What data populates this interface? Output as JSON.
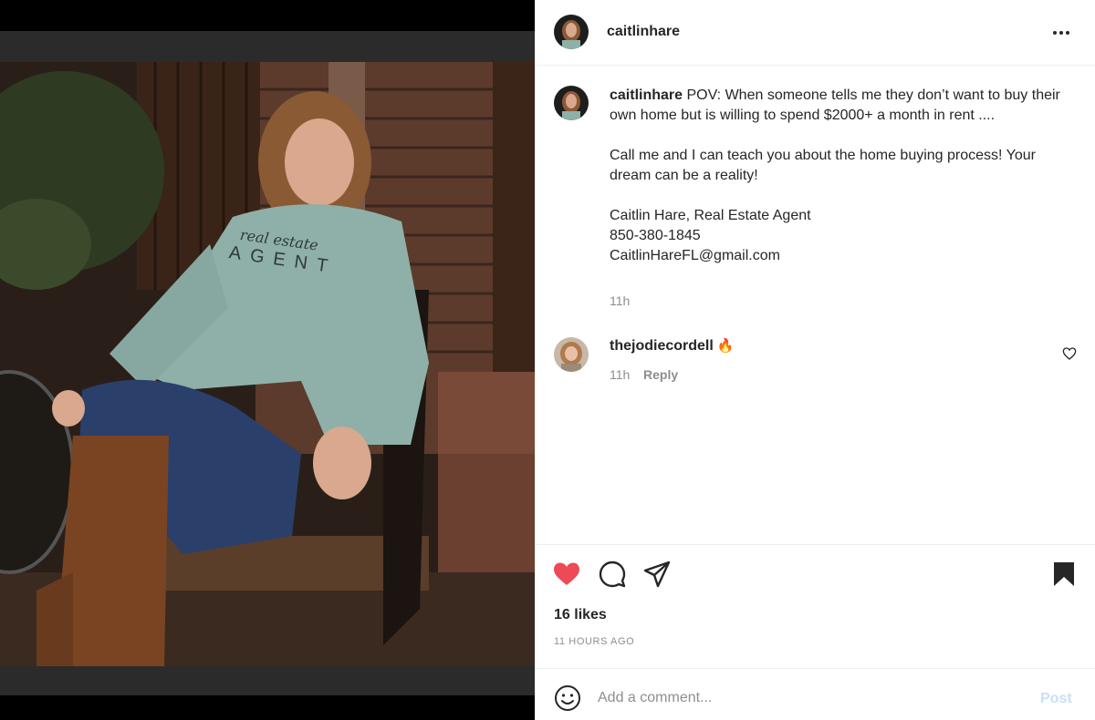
{
  "post": {
    "author": "caitlinhare",
    "caption_body_line1": "POV: When someone tells me they don’t want to buy their own home but is willing to spend $2000+ a month in rent ....",
    "caption_line2": "Call me and I can teach you about the home buying process! Your dream can be a reality!",
    "caption_line3": "Caitlin Hare, Real Estate Agent",
    "caption_line4": "850-380-1845",
    "caption_line5": "CaitlinHareFL@gmail.com",
    "caption_time": "11h",
    "likes": "16 likes",
    "posted_ago": "11 HOURS AGO",
    "is_liked": true,
    "is_saved": true
  },
  "comments": [
    {
      "author": "thejodiecordell",
      "emoji": "🔥",
      "time": "11h",
      "reply_label": "Reply"
    }
  ],
  "composer": {
    "placeholder": "Add a comment...",
    "post_label": "Post"
  },
  "media": {
    "sweatshirt_text_script": "real estate",
    "sweatshirt_text_caps": "AGENT"
  },
  "colors": {
    "like_red": "#ed4956",
    "text_primary": "#262626",
    "text_secondary": "#8e8e8e",
    "post_disabled": "#c7dff7"
  },
  "icons": {
    "header_menu": "more-horizontal-icon",
    "like": "heart-filled-icon",
    "comment": "comment-bubble-icon",
    "share": "paper-plane-icon",
    "save": "bookmark-filled-icon",
    "comment_like": "heart-outline-icon",
    "emoji": "smiley-icon"
  }
}
